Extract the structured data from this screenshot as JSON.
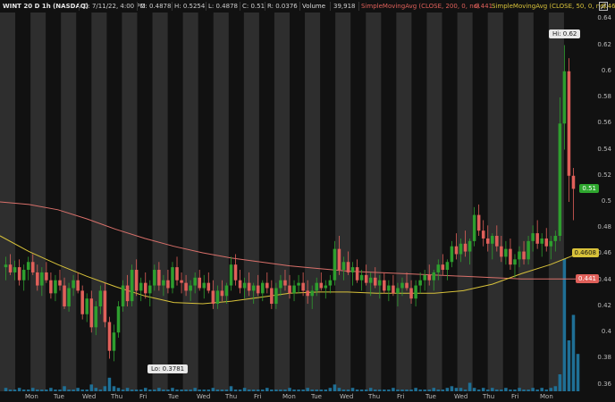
{
  "header": {
    "symbol": "WINT 20 D 1h (NASDAQ)",
    "date": "D: 7/11/22, 4:00 PM",
    "open": "O: 0.4878",
    "high": "H: 0.5254",
    "low": "L: 0.4878",
    "close": "C: 0.51",
    "range": "R: 0.0376",
    "volume_label": "Volume",
    "volume_value": "39,918",
    "sma200_label": "SimpleMovingAvg (CLOSE, 200, 0, no)",
    "sma200_value": "0.441",
    "sma50_label": "SimpleMovingAvg (CLOSE, 50, 0, no)",
    "sma50_value": "0.4608"
  },
  "colors": {
    "background": "#111111",
    "session_band": "#2e2e2e",
    "up_candle": "#2e9e2e",
    "down_candle": "#e0605a",
    "sma200": "#d9706a",
    "sma50": "#d8c23a",
    "volume": "#1f6f95"
  },
  "y_axis": {
    "ticks": [
      "0.64",
      "0.62",
      "0.6",
      "0.58",
      "0.56",
      "0.54",
      "0.52",
      "0.5",
      "0.48",
      "0.46",
      "0.44",
      "0.42",
      "0.4",
      "0.38",
      "0.36"
    ]
  },
  "price_tags": {
    "last": "0.51",
    "sma50": "0.4608",
    "sma200": "0.441"
  },
  "callouts": {
    "high": "Hi: 0.62",
    "low": "Lo: 0.3781"
  },
  "chart_data": {
    "type": "candlestick",
    "ylim": [
      0.355,
      0.645
    ],
    "x_day_labels": [
      "Mon",
      "Tue",
      "Wed",
      "Thu",
      "Fri",
      "Tue",
      "Wed",
      "Thu",
      "Fri",
      "Mon",
      "Tue",
      "Wed",
      "Thu",
      "Fri",
      "Tue",
      "Wed",
      "Thu",
      "Fri",
      "Mon"
    ],
    "candles": [
      [
        0.45,
        0.458,
        0.44,
        0.452
      ],
      [
        0.452,
        0.46,
        0.444,
        0.446
      ],
      [
        0.446,
        0.455,
        0.44,
        0.45
      ],
      [
        0.45,
        0.456,
        0.436,
        0.44
      ],
      [
        0.44,
        0.452,
        0.432,
        0.448
      ],
      [
        0.448,
        0.458,
        0.44,
        0.454
      ],
      [
        0.454,
        0.46,
        0.444,
        0.446
      ],
      [
        0.446,
        0.452,
        0.432,
        0.436
      ],
      [
        0.436,
        0.45,
        0.428,
        0.446
      ],
      [
        0.446,
        0.454,
        0.438,
        0.44
      ],
      [
        0.44,
        0.446,
        0.426,
        0.43
      ],
      [
        0.43,
        0.444,
        0.424,
        0.44
      ],
      [
        0.44,
        0.448,
        0.432,
        0.436
      ],
      [
        0.436,
        0.442,
        0.418,
        0.42
      ],
      [
        0.42,
        0.438,
        0.416,
        0.434
      ],
      [
        0.434,
        0.444,
        0.428,
        0.44
      ],
      [
        0.44,
        0.446,
        0.43,
        0.432
      ],
      [
        0.432,
        0.436,
        0.41,
        0.414
      ],
      [
        0.414,
        0.43,
        0.408,
        0.426
      ],
      [
        0.426,
        0.432,
        0.4,
        0.404
      ],
      [
        0.404,
        0.424,
        0.398,
        0.42
      ],
      [
        0.42,
        0.436,
        0.414,
        0.432
      ],
      [
        0.432,
        0.438,
        0.404,
        0.408
      ],
      [
        0.408,
        0.412,
        0.38,
        0.386
      ],
      [
        0.386,
        0.406,
        0.378,
        0.4
      ],
      [
        0.4,
        0.424,
        0.396,
        0.42
      ],
      [
        0.42,
        0.44,
        0.416,
        0.436
      ],
      [
        0.436,
        0.444,
        0.42,
        0.424
      ],
      [
        0.424,
        0.452,
        0.42,
        0.448
      ],
      [
        0.448,
        0.456,
        0.428,
        0.432
      ],
      [
        0.432,
        0.442,
        0.424,
        0.438
      ],
      [
        0.438,
        0.446,
        0.426,
        0.43
      ],
      [
        0.43,
        0.44,
        0.42,
        0.436
      ],
      [
        0.436,
        0.452,
        0.432,
        0.448
      ],
      [
        0.448,
        0.454,
        0.432,
        0.436
      ],
      [
        0.436,
        0.444,
        0.428,
        0.44
      ],
      [
        0.44,
        0.448,
        0.43,
        0.434
      ],
      [
        0.434,
        0.454,
        0.43,
        0.45
      ],
      [
        0.45,
        0.458,
        0.436,
        0.44
      ],
      [
        0.44,
        0.446,
        0.43,
        0.438
      ],
      [
        0.438,
        0.444,
        0.428,
        0.432
      ],
      [
        0.432,
        0.44,
        0.424,
        0.436
      ],
      [
        0.436,
        0.446,
        0.43,
        0.442
      ],
      [
        0.442,
        0.448,
        0.432,
        0.434
      ],
      [
        0.434,
        0.444,
        0.426,
        0.438
      ],
      [
        0.438,
        0.446,
        0.43,
        0.432
      ],
      [
        0.432,
        0.44,
        0.418,
        0.422
      ],
      [
        0.422,
        0.436,
        0.418,
        0.432
      ],
      [
        0.432,
        0.44,
        0.424,
        0.428
      ],
      [
        0.428,
        0.438,
        0.422,
        0.436
      ],
      [
        0.436,
        0.458,
        0.432,
        0.452
      ],
      [
        0.452,
        0.46,
        0.436,
        0.44
      ],
      [
        0.44,
        0.448,
        0.43,
        0.434
      ],
      [
        0.434,
        0.442,
        0.426,
        0.438
      ],
      [
        0.438,
        0.446,
        0.428,
        0.432
      ],
      [
        0.432,
        0.438,
        0.422,
        0.436
      ],
      [
        0.436,
        0.444,
        0.428,
        0.43
      ],
      [
        0.43,
        0.44,
        0.424,
        0.438
      ],
      [
        0.438,
        0.446,
        0.43,
        0.434
      ],
      [
        0.434,
        0.44,
        0.418,
        0.422
      ],
      [
        0.422,
        0.438,
        0.418,
        0.434
      ],
      [
        0.434,
        0.444,
        0.428,
        0.44
      ],
      [
        0.44,
        0.448,
        0.432,
        0.436
      ],
      [
        0.436,
        0.444,
        0.426,
        0.43
      ],
      [
        0.43,
        0.44,
        0.424,
        0.436
      ],
      [
        0.436,
        0.444,
        0.43,
        0.438
      ],
      [
        0.438,
        0.446,
        0.428,
        0.432
      ],
      [
        0.432,
        0.44,
        0.422,
        0.428
      ],
      [
        0.428,
        0.436,
        0.418,
        0.432
      ],
      [
        0.432,
        0.442,
        0.428,
        0.438
      ],
      [
        0.438,
        0.446,
        0.432,
        0.434
      ],
      [
        0.434,
        0.44,
        0.426,
        0.436
      ],
      [
        0.436,
        0.444,
        0.43,
        0.44
      ],
      [
        0.44,
        0.47,
        0.436,
        0.464
      ],
      [
        0.464,
        0.474,
        0.444,
        0.448
      ],
      [
        0.448,
        0.458,
        0.44,
        0.454
      ],
      [
        0.454,
        0.462,
        0.444,
        0.446
      ],
      [
        0.446,
        0.454,
        0.436,
        0.45
      ],
      [
        0.45,
        0.456,
        0.438,
        0.44
      ],
      [
        0.44,
        0.448,
        0.432,
        0.444
      ],
      [
        0.444,
        0.452,
        0.436,
        0.438
      ],
      [
        0.438,
        0.446,
        0.428,
        0.442
      ],
      [
        0.442,
        0.45,
        0.434,
        0.436
      ],
      [
        0.436,
        0.444,
        0.426,
        0.44
      ],
      [
        0.44,
        0.446,
        0.43,
        0.432
      ],
      [
        0.432,
        0.44,
        0.424,
        0.436
      ],
      [
        0.436,
        0.444,
        0.428,
        0.43
      ],
      [
        0.43,
        0.438,
        0.42,
        0.434
      ],
      [
        0.434,
        0.442,
        0.428,
        0.438
      ],
      [
        0.438,
        0.446,
        0.432,
        0.434
      ],
      [
        0.434,
        0.44,
        0.422,
        0.426
      ],
      [
        0.426,
        0.44,
        0.42,
        0.436
      ],
      [
        0.436,
        0.446,
        0.43,
        0.44
      ],
      [
        0.44,
        0.448,
        0.432,
        0.444
      ],
      [
        0.444,
        0.452,
        0.436,
        0.44
      ],
      [
        0.44,
        0.448,
        0.432,
        0.446
      ],
      [
        0.446,
        0.456,
        0.44,
        0.452
      ],
      [
        0.452,
        0.46,
        0.444,
        0.448
      ],
      [
        0.448,
        0.456,
        0.44,
        0.454
      ],
      [
        0.454,
        0.47,
        0.45,
        0.466
      ],
      [
        0.466,
        0.476,
        0.456,
        0.46
      ],
      [
        0.46,
        0.472,
        0.454,
        0.468
      ],
      [
        0.468,
        0.478,
        0.458,
        0.462
      ],
      [
        0.462,
        0.472,
        0.452,
        0.47
      ],
      [
        0.47,
        0.496,
        0.466,
        0.49
      ],
      [
        0.49,
        0.498,
        0.474,
        0.478
      ],
      [
        0.478,
        0.486,
        0.466,
        0.472
      ],
      [
        0.472,
        0.482,
        0.462,
        0.468
      ],
      [
        0.468,
        0.476,
        0.456,
        0.474
      ],
      [
        0.474,
        0.482,
        0.462,
        0.466
      ],
      [
        0.466,
        0.474,
        0.454,
        0.458
      ],
      [
        0.458,
        0.47,
        0.452,
        0.464
      ],
      [
        0.464,
        0.472,
        0.448,
        0.452
      ],
      [
        0.452,
        0.46,
        0.442,
        0.456
      ],
      [
        0.456,
        0.466,
        0.45,
        0.462
      ],
      [
        0.462,
        0.47,
        0.452,
        0.456
      ],
      [
        0.456,
        0.474,
        0.452,
        0.47
      ],
      [
        0.47,
        0.482,
        0.462,
        0.476
      ],
      [
        0.476,
        0.486,
        0.464,
        0.468
      ],
      [
        0.468,
        0.476,
        0.458,
        0.472
      ],
      [
        0.472,
        0.48,
        0.462,
        0.466
      ],
      [
        0.466,
        0.474,
        0.456,
        0.47
      ],
      [
        0.47,
        0.478,
        0.462,
        0.474
      ],
      [
        0.474,
        0.58,
        0.47,
        0.56
      ],
      [
        0.56,
        0.62,
        0.54,
        0.6
      ],
      [
        0.6,
        0.61,
        0.5,
        0.52
      ],
      [
        0.52,
        0.526,
        0.486,
        0.51
      ]
    ],
    "volume": [
      0.02,
      0.01,
      0.01,
      0.02,
      0.01,
      0.01,
      0.02,
      0.01,
      0.01,
      0.01,
      0.02,
      0.01,
      0.01,
      0.03,
      0.01,
      0.01,
      0.02,
      0.01,
      0.01,
      0.04,
      0.02,
      0.01,
      0.03,
      0.08,
      0.03,
      0.02,
      0.01,
      0.02,
      0.01,
      0.01,
      0.01,
      0.02,
      0.01,
      0.01,
      0.02,
      0.01,
      0.01,
      0.02,
      0.01,
      0.01,
      0.01,
      0.01,
      0.02,
      0.01,
      0.01,
      0.01,
      0.02,
      0.01,
      0.01,
      0.01,
      0.03,
      0.01,
      0.01,
      0.02,
      0.01,
      0.01,
      0.01,
      0.01,
      0.02,
      0.01,
      0.01,
      0.01,
      0.01,
      0.02,
      0.01,
      0.01,
      0.01,
      0.02,
      0.01,
      0.01,
      0.01,
      0.01,
      0.02,
      0.04,
      0.02,
      0.01,
      0.01,
      0.02,
      0.01,
      0.01,
      0.01,
      0.02,
      0.01,
      0.01,
      0.01,
      0.01,
      0.02,
      0.01,
      0.01,
      0.01,
      0.01,
      0.02,
      0.01,
      0.01,
      0.01,
      0.02,
      0.01,
      0.01,
      0.02,
      0.03,
      0.02,
      0.02,
      0.01,
      0.05,
      0.02,
      0.01,
      0.02,
      0.01,
      0.02,
      0.01,
      0.01,
      0.02,
      0.01,
      0.01,
      0.02,
      0.01,
      0.01,
      0.02,
      0.01,
      0.02,
      0.01,
      0.02,
      0.03,
      0.1,
      0.78,
      0.3,
      0.45,
      0.22
    ],
    "sma200": [
      [
        0,
        0.5
      ],
      [
        0.05,
        0.498
      ],
      [
        0.1,
        0.494
      ],
      [
        0.15,
        0.487
      ],
      [
        0.2,
        0.479
      ],
      [
        0.25,
        0.472
      ],
      [
        0.3,
        0.466
      ],
      [
        0.35,
        0.461
      ],
      [
        0.4,
        0.457
      ],
      [
        0.45,
        0.454
      ],
      [
        0.5,
        0.451
      ],
      [
        0.55,
        0.449
      ],
      [
        0.6,
        0.447
      ],
      [
        0.65,
        0.446
      ],
      [
        0.7,
        0.445
      ],
      [
        0.75,
        0.444
      ],
      [
        0.8,
        0.443
      ],
      [
        0.85,
        0.442
      ],
      [
        0.9,
        0.441
      ],
      [
        0.95,
        0.441
      ],
      [
        1.0,
        0.441
      ]
    ],
    "sma50": [
      [
        0,
        0.474
      ],
      [
        0.05,
        0.462
      ],
      [
        0.1,
        0.452
      ],
      [
        0.15,
        0.443
      ],
      [
        0.2,
        0.435
      ],
      [
        0.25,
        0.428
      ],
      [
        0.3,
        0.423
      ],
      [
        0.35,
        0.422
      ],
      [
        0.4,
        0.424
      ],
      [
        0.45,
        0.427
      ],
      [
        0.5,
        0.43
      ],
      [
        0.55,
        0.431
      ],
      [
        0.6,
        0.431
      ],
      [
        0.65,
        0.43
      ],
      [
        0.7,
        0.43
      ],
      [
        0.75,
        0.43
      ],
      [
        0.8,
        0.432
      ],
      [
        0.85,
        0.437
      ],
      [
        0.9,
        0.445
      ],
      [
        0.95,
        0.452
      ],
      [
        1.0,
        0.4608
      ]
    ]
  }
}
